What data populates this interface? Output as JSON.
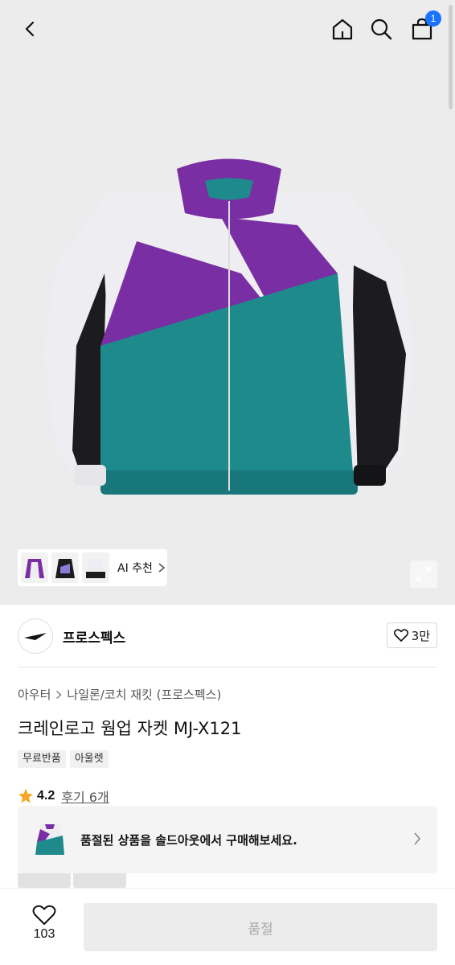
{
  "header": {
    "cart_badge": "1"
  },
  "hero": {
    "ai_recommend_label": "AI 추천"
  },
  "brand": {
    "name": "프로스펙스",
    "like_count": "3만"
  },
  "breadcrumb": {
    "category": "아우터",
    "subcategory": "나일론/코치 재킷 (프로스펙스)"
  },
  "product": {
    "title": "크레인로고 웜업 자켓 MJ-X121",
    "tags": [
      "무료반품",
      "아울렛"
    ],
    "rating": "4.2",
    "reviews": "후기 6개"
  },
  "soldout_banner": {
    "text": "품절된 상품을 솔드아웃에서 구매해보세요."
  },
  "bottom_bar": {
    "wish_count": "103",
    "buy_label": "품절"
  },
  "colors": {
    "teal": "#1e8a8c",
    "purple": "#7a2ea3",
    "white_panel": "#eeeef2",
    "black_panel": "#1c1c1e",
    "badge_blue": "#1a73ff",
    "star": "#f5a623"
  }
}
